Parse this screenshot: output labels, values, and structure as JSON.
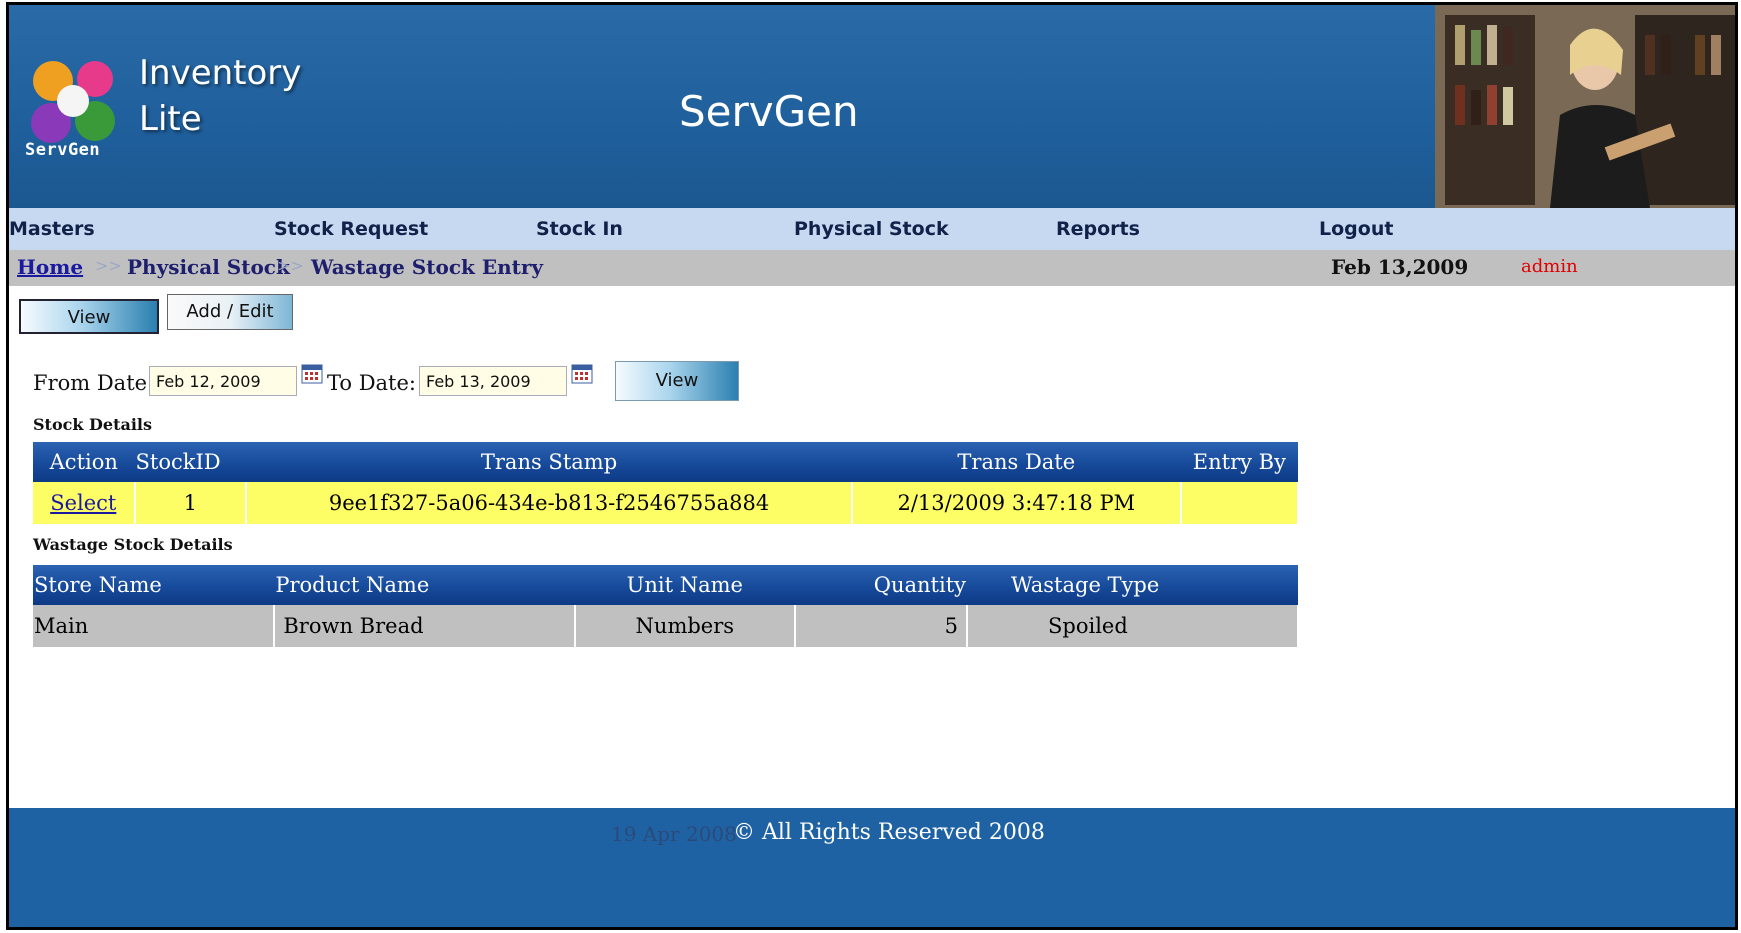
{
  "header": {
    "logo_word": "ServGen",
    "app_name_line1": "Inventory",
    "app_name_line2": "Lite",
    "company": "ServGen"
  },
  "nav": {
    "masters": "Masters",
    "stock_request": "Stock Request",
    "stock_in": "Stock In",
    "physical_stock": "Physical Stock",
    "reports": "Reports",
    "logout": "Logout"
  },
  "breadcrumb": {
    "home": "Home",
    "separator": ">>",
    "level1": "Physical Stock",
    "level2": "Wastage Stock Entry",
    "date": "Feb 13,2009",
    "user": "admin"
  },
  "tabs": {
    "view": "View",
    "add_edit": "Add / Edit"
  },
  "filter": {
    "from_label": "From Date:",
    "from_value": "Feb 12, 2009",
    "to_label": "To Date:",
    "to_value": "Feb 13, 2009",
    "view_button": "View"
  },
  "stock_details": {
    "title": "Stock Details",
    "headers": [
      "Action",
      "StockID",
      "Trans Stamp",
      "Trans Date",
      "Entry By"
    ],
    "rows": [
      {
        "action": "Select",
        "stock_id": "1",
        "trans_stamp": "9ee1f327-5a06-434e-b813-f2546755a884",
        "trans_date": "2/13/2009 3:47:18 PM",
        "entry_by": ""
      }
    ]
  },
  "wastage_details": {
    "title": "Wastage Stock Details",
    "headers": [
      "Store Name",
      "Product Name",
      "Unit Name",
      "Quantity",
      "Wastage Type"
    ],
    "rows": [
      {
        "store": "Main",
        "product": "Brown Bread",
        "unit": "Numbers",
        "quantity": "5",
        "type": "Spoiled"
      }
    ]
  },
  "footer": {
    "stamp": "19 Apr 2008",
    "copyright": "© All Rights Reserved 2008"
  },
  "colors": {
    "header_blue": "#1f5f9c",
    "nav_bg": "#c7d9f0",
    "breadcrumb_bg": "#c0c0c0",
    "selected_row": "#fdfd66",
    "table_header": "#174a9a",
    "user_red": "#e00000"
  }
}
